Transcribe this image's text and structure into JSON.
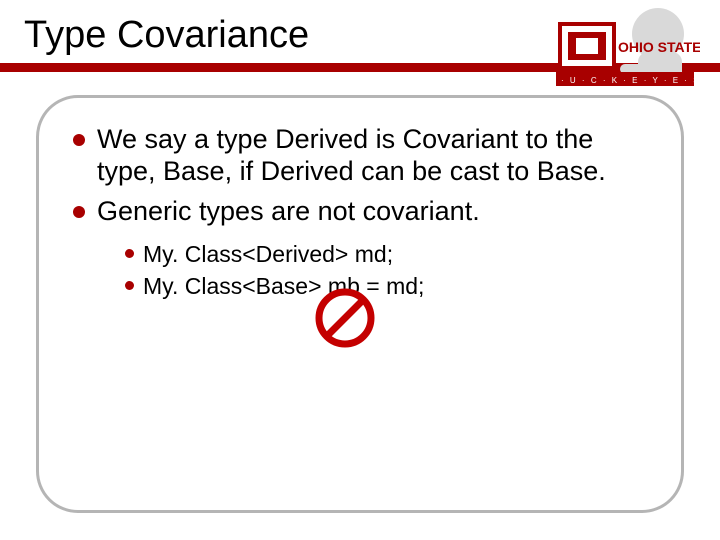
{
  "title": "Type Covariance",
  "logo": {
    "top_text": "OHIO STATE",
    "bottom_text": "B · U · C · K · E · Y · E · S"
  },
  "bullets": {
    "b1": "We say a type Derived is Covariant to the type, Base, if Derived can be cast to Base.",
    "b2": "Generic types are not covariant.",
    "sub1": "My. Class<Derived> md;",
    "sub2": "My. Class<Base> mb = md;"
  },
  "icon": {
    "name": "prohibited"
  }
}
